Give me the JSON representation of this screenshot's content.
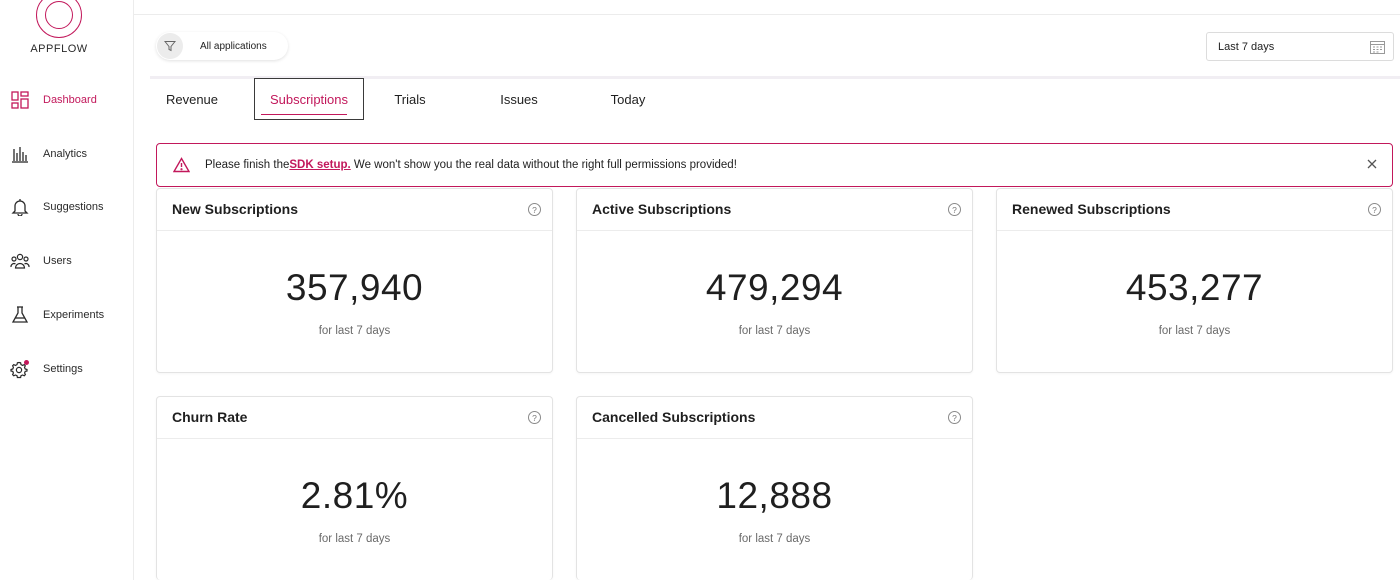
{
  "brand": {
    "name": "APPFLOW",
    "accent": "#c2185b"
  },
  "sidebar": {
    "items": [
      {
        "label": "Dashboard",
        "icon": "dashboard-icon",
        "active": true
      },
      {
        "label": "Analytics",
        "icon": "bar-chart-icon",
        "active": false
      },
      {
        "label": "Suggestions",
        "icon": "bell-icon",
        "active": false
      },
      {
        "label": "Users",
        "icon": "users-icon",
        "active": false
      },
      {
        "label": "Experiments",
        "icon": "flask-icon",
        "active": false
      },
      {
        "label": "Settings",
        "icon": "gear-icon",
        "active": false
      }
    ]
  },
  "toolbar": {
    "filter_label": "All applications",
    "filter_icon": "filter-icon",
    "date_range": "Last 7 days",
    "calendar_icon": "calendar-icon"
  },
  "tabs": [
    {
      "label": "Revenue",
      "active": false
    },
    {
      "label": "Subscriptions",
      "active": true
    },
    {
      "label": "Trials",
      "active": false
    },
    {
      "label": "Issues",
      "active": false
    },
    {
      "label": "Today",
      "active": false
    }
  ],
  "alert": {
    "prefix": "Please finish the",
    "link": "SDK setup.",
    "suffix": " We won't show you the real data without the right full permissions provided!",
    "icon": "warning-icon",
    "close_icon": "close-icon"
  },
  "cards": [
    {
      "title": "New Subscriptions",
      "value": "357,940",
      "subtitle": "for last 7 days"
    },
    {
      "title": "Active Subscriptions",
      "value": "479,294",
      "subtitle": "for last 7 days"
    },
    {
      "title": "Renewed Subscriptions",
      "value": "453,277",
      "subtitle": "for last 7 days"
    },
    {
      "title": "Churn Rate",
      "value": "2.81%",
      "subtitle": "for last 7 days"
    },
    {
      "title": "Cancelled Subscriptions",
      "value": "12,888",
      "subtitle": "for last 7 days"
    }
  ],
  "help_glyph": "?"
}
